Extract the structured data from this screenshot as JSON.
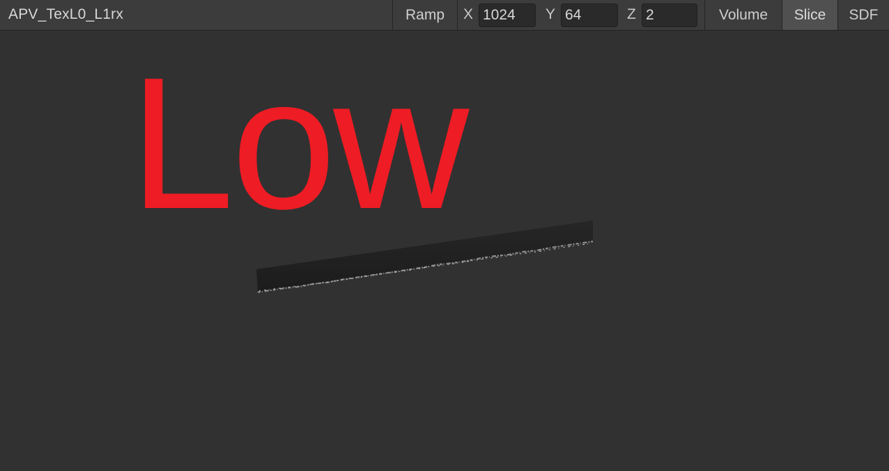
{
  "window": {
    "title": "APV_TexL0_L1rx"
  },
  "toolbar": {
    "ramp_label": "Ramp",
    "x_label": "X",
    "x_value": "1024",
    "y_label": "Y",
    "y_value": "64",
    "z_label": "Z",
    "z_value": "2",
    "volume_label": "Volume",
    "slice_label": "Slice",
    "sdf_label": "SDF",
    "active_mode": "Slice"
  },
  "viewport": {
    "overlay_text": "Low",
    "overlay_color": "#ee1c24",
    "background_color": "#313131"
  }
}
